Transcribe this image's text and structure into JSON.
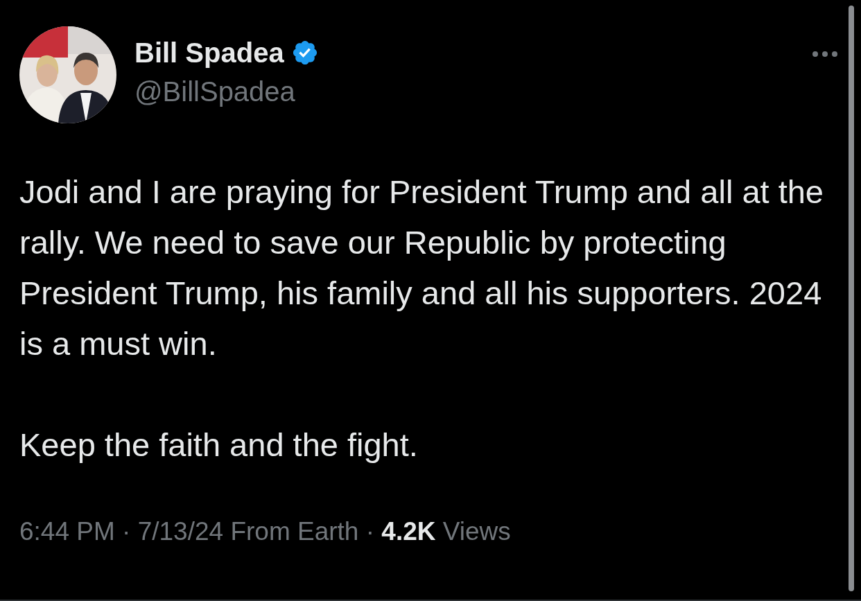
{
  "author": {
    "name": "Bill Spadea",
    "verified": true,
    "handle": "@BillSpadea"
  },
  "paragraphs": [
    "Jodi and I are praying for President Trump and all at the rally. We need to save our Republic by protecting President Trump, his family and all his supporters. 2024 is a must win.",
    "Keep the faith and the fight."
  ],
  "footer": "6:44 PM · 7/13/24 From Earth · **4.2K** Views"
}
